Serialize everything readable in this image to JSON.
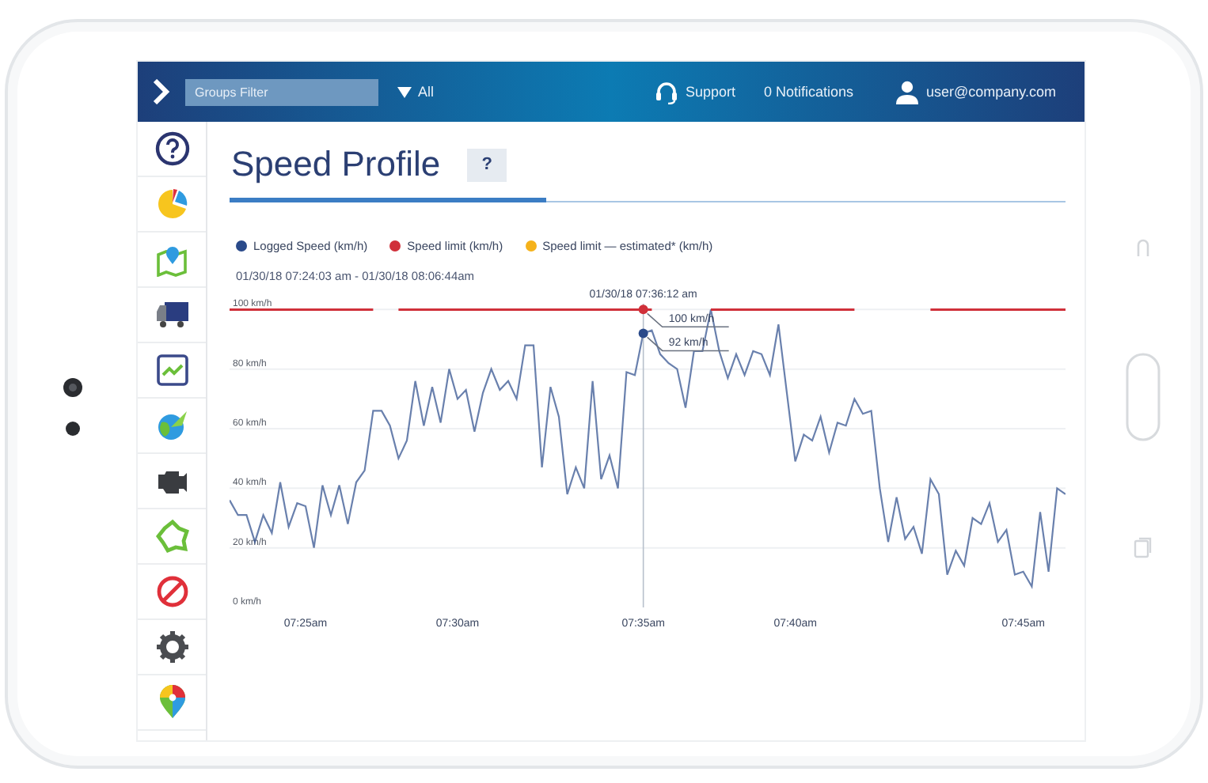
{
  "header": {
    "search": {
      "placeholder": "Groups Filter"
    },
    "filter": {
      "value": "All"
    },
    "support": "Support",
    "notifications": "0 Notifications",
    "user": "user@company.com"
  },
  "page": {
    "title": "Speed Profile",
    "help": "?"
  },
  "date_range": "01/30/18 07:24:03 am - 01/30/18 08:06:44am",
  "chart": {
    "chart_data": {
      "type": "line",
      "grid": true,
      "ylim": [
        0,
        103
      ],
      "categories": [
        null,
        null,
        null,
        null,
        null,
        null,
        null,
        null,
        null,
        "07:25am",
        null,
        null,
        null,
        null,
        null,
        null,
        null,
        null,
        null,
        null,
        null,
        null,
        null,
        null,
        null,
        null,
        null,
        "07:30am",
        null,
        null,
        null,
        null,
        null,
        null,
        null,
        null,
        null,
        null,
        null,
        null,
        null,
        null,
        null,
        null,
        null,
        null,
        null,
        null,
        null,
        "07:35am",
        null,
        null,
        null,
        null,
        null,
        null,
        null,
        null,
        null,
        null,
        null,
        null,
        null,
        null,
        null,
        null,
        null,
        "07:40am",
        null,
        null,
        null,
        null,
        null,
        null,
        null,
        null,
        null,
        null,
        null,
        null,
        null,
        null,
        null,
        null,
        null,
        null,
        null,
        null,
        null,
        null,
        null,
        null,
        null,
        null,
        "07:45am",
        null,
        null,
        null,
        null,
        null
      ],
      "series": [
        {
          "name": "Logged Speed (km/h)",
          "color": "#2a4a8a",
          "values": [
            36,
            31,
            31,
            22,
            31,
            25,
            42,
            27,
            35,
            34,
            20,
            41,
            31,
            41,
            28,
            42,
            46,
            66,
            66,
            61,
            50,
            56,
            76,
            61,
            74,
            62,
            80,
            70,
            73,
            59,
            72,
            80,
            73,
            76,
            70,
            88,
            88,
            47,
            74,
            64,
            38,
            47,
            40,
            76,
            43,
            51,
            40,
            79,
            78,
            92,
            93,
            85,
            82,
            80,
            67,
            86,
            86,
            100,
            86,
            77,
            85,
            78,
            86,
            85,
            78,
            95,
            72,
            49,
            58,
            56,
            64,
            52,
            62,
            61,
            70,
            65,
            66,
            40,
            22,
            37,
            23,
            27,
            18,
            43,
            38,
            11,
            19,
            14,
            30,
            28,
            35,
            22,
            26,
            11,
            12,
            7,
            32,
            12,
            40,
            38
          ]
        },
        {
          "name": "Speed limit (km/h)",
          "color": "#d0303a",
          "values": [
            100,
            100,
            100,
            100,
            100,
            100,
            100,
            100,
            100,
            100,
            100,
            100,
            100,
            100,
            100,
            100,
            100,
            100,
            null,
            null,
            100,
            100,
            100,
            100,
            100,
            100,
            100,
            100,
            100,
            100,
            100,
            100,
            100,
            100,
            100,
            100,
            100,
            100,
            100,
            100,
            100,
            100,
            100,
            100,
            100,
            100,
            100,
            100,
            100,
            100,
            100,
            null,
            null,
            null,
            null,
            null,
            null,
            100,
            100,
            100,
            100,
            100,
            100,
            100,
            100,
            100,
            100,
            100,
            100,
            100,
            100,
            100,
            100,
            100,
            100,
            null,
            null,
            null,
            null,
            null,
            null,
            null,
            null,
            100,
            100,
            100,
            100,
            100,
            100,
            100,
            100,
            100,
            100,
            100,
            100,
            100,
            100,
            100,
            100,
            100
          ]
        },
        {
          "name": "Speed limit — estimated* (km/h)",
          "color": "#f5b21b",
          "values": [
            null,
            null,
            null,
            null,
            null,
            null,
            null,
            null,
            null,
            null,
            null,
            null,
            null,
            null,
            null,
            null,
            null,
            null,
            null,
            null,
            null,
            null,
            null,
            null,
            null,
            null,
            null,
            null,
            null,
            null,
            null,
            null,
            null,
            null,
            null,
            null,
            null,
            null,
            null,
            null,
            null,
            null,
            null,
            null,
            null,
            null,
            null,
            null,
            null,
            null,
            null,
            null,
            null,
            null,
            null,
            null,
            null,
            null,
            null,
            null,
            null,
            null,
            null,
            null,
            null,
            null,
            null,
            null,
            null,
            null,
            null,
            null,
            null,
            null,
            null,
            null,
            null,
            null,
            null,
            null,
            null,
            null,
            null,
            null,
            null,
            null,
            null,
            null,
            null,
            null,
            null,
            null,
            null,
            null,
            null,
            null,
            null,
            null,
            null,
            null
          ]
        }
      ],
      "yticks": [
        {
          "value": 0,
          "label": "0 km/h"
        },
        {
          "value": 20,
          "label": "20 km/h"
        },
        {
          "value": 40,
          "label": "40 km/h"
        },
        {
          "value": 60,
          "label": "60 km/h"
        },
        {
          "value": 80,
          "label": "80 km/h"
        },
        {
          "value": 100,
          "label": "100 km/h"
        }
      ],
      "annotations": [
        {
          "x": "07:35am",
          "text": "01/30/18 07:36:12 am"
        },
        {
          "x": "07:35am",
          "y": 100,
          "text": "100 km/h"
        },
        {
          "x": "07:35am",
          "y": 92,
          "text": "92 km/h"
        }
      ]
    }
  }
}
